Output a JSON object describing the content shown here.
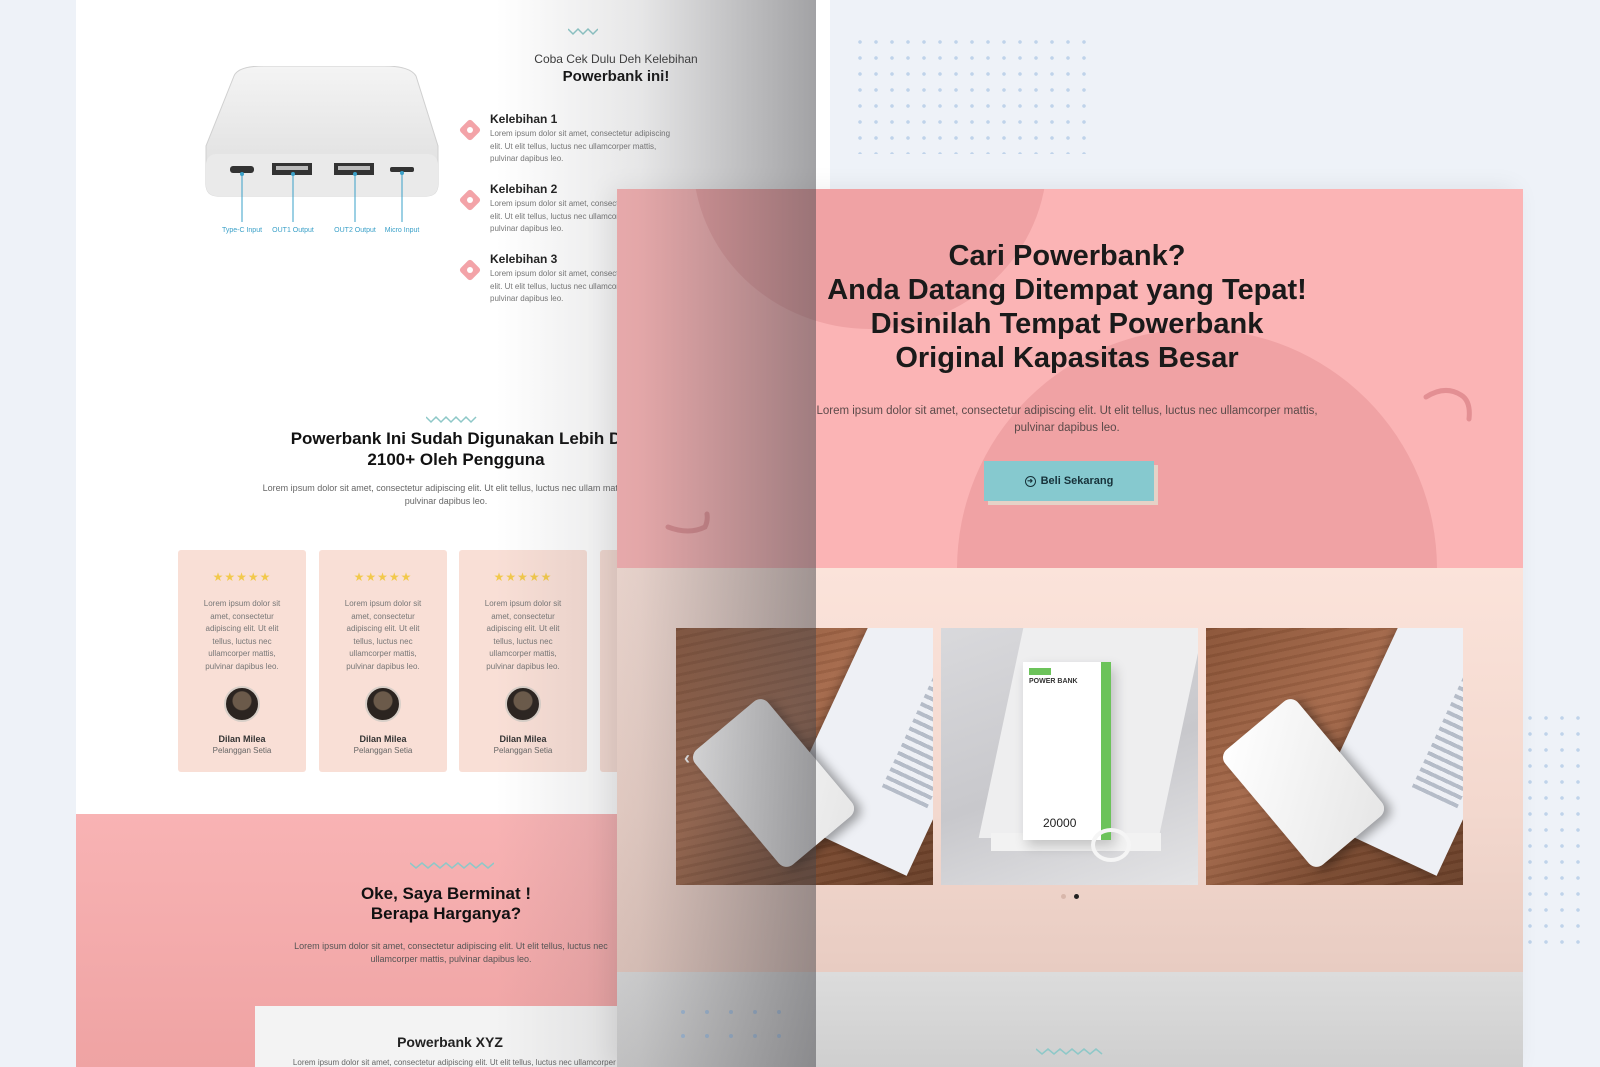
{
  "back_page": {
    "advantages_subtitle": "Coba Cek Dulu Deh Kelebihan",
    "advantages_title": "Powerbank ini!",
    "product_ports": [
      "Type-C Input",
      "OUT1 Output",
      "OUT2 Output",
      "Micro Input"
    ],
    "advantages": [
      {
        "title": "Kelebihan 1",
        "text": "Lorem ipsum dolor sit amet, consectetur adipiscing elit. Ut elit tellus, luctus nec ullamcorper mattis, pulvinar dapibus leo."
      },
      {
        "title": "Kelebihan 2",
        "text": "Lorem ipsum dolor sit amet, consectetur adipiscing elit. Ut elit tellus, luctus nec ullamcorper mattis, pulvinar dapibus leo."
      },
      {
        "title": "Kelebihan 3",
        "text": "Lorem ipsum dolor sit amet, consectetur adipiscing elit. Ut elit tellus, luctus nec ullamcorper mattis, pulvinar dapibus leo."
      }
    ],
    "users_title_line1": "Powerbank Ini Sudah Digunakan Lebih D",
    "users_title_line2": "2100+ Oleh Pengguna",
    "users_desc": "Lorem ipsum dolor sit amet, consectetur adipiscing elit. Ut elit tellus, luctus nec ullam mattis, pulvinar dapibus leo.",
    "reviews": [
      {
        "stars": "★★★★★",
        "text": "Lorem ipsum dolor sit amet, consectetur adipiscing elit. Ut elit tellus, luctus nec ullamcorper mattis, pulvinar dapibus leo.",
        "name": "Dilan Milea",
        "role": "Pelanggan Setia"
      },
      {
        "stars": "★★★★★",
        "text": "Lorem ipsum dolor sit amet, consectetur adipiscing elit. Ut elit tellus, luctus nec ullamcorper mattis, pulvinar dapibus leo.",
        "name": "Dilan Milea",
        "role": "Pelanggan Setia"
      },
      {
        "stars": "★★★★★",
        "text": "Lorem ipsum dolor sit amet, consectetur adipiscing elit. Ut elit tellus, luctus nec ullamcorper mattis, pulvinar dapibus leo.",
        "name": "Dilan Milea",
        "role": "Pelanggan Setia"
      }
    ],
    "pricing_title_line1": "Oke, Saya Berminat !",
    "pricing_title_line2": "Berapa Harganya?",
    "pricing_desc": "Lorem ipsum dolor sit amet, consectetur adipiscing elit. Ut elit tellus, luctus nec ullamcorper mattis, pulvinar dapibus leo.",
    "card_title": "Powerbank XYZ",
    "card_desc": "Lorem ipsum dolor sit amet, consectetur adipiscing elit. Ut elit tellus, luctus nec ullamcorper ma"
  },
  "front_page": {
    "hero_title_lines": [
      "Cari Powerbank?",
      "Anda Datang Ditempat yang Tepat!",
      "Disinilah Tempat Powerbank",
      "Original Kapasitas Besar"
    ],
    "hero_desc": "Lorem ipsum dolor sit amet, consectetur adipiscing elit. Ut elit tellus, luctus nec ullamcorper mattis, pulvinar dapibus leo.",
    "buy_button_label": "Beli Sekarang",
    "buy_button_icon": "arrow-circle-right-icon",
    "gallery_box_label": "POWER BANK",
    "gallery_box_capacity": "20000",
    "carousel_active_index": 1,
    "carousel_count": 2
  },
  "colors": {
    "hero_pink": "#fbb4b5",
    "blob_pink": "#f0a2a4",
    "accent_teal": "#86c9cf",
    "review_bg": "#f9dfd6",
    "star_yellow": "#f2c94c"
  }
}
